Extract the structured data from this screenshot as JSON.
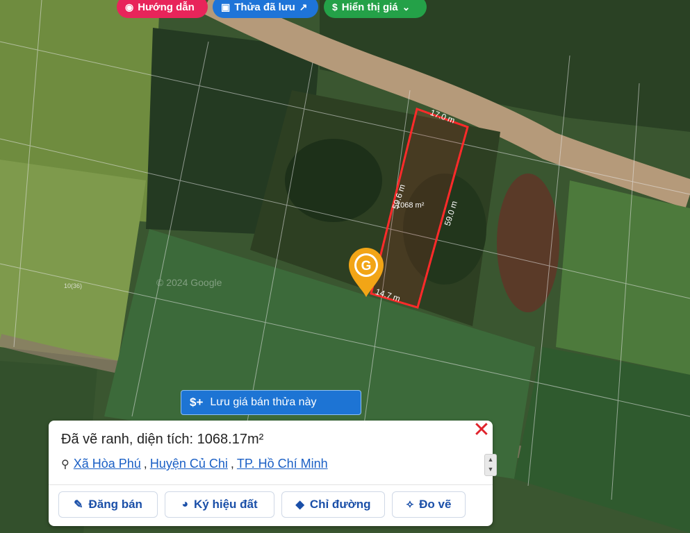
{
  "top_buttons": {
    "guide_label": "Hướng dẫn",
    "saved_label": "Thửa đã lưu",
    "price_label": "Hiển thị giá"
  },
  "map": {
    "watermark": "© 2024 Google",
    "parcel_top_dim": "17.0 m",
    "parcel_left_dim": "59.6 m",
    "parcel_right_dim": "59.0 m",
    "parcel_bottom_dim": "14.7 m",
    "parcel_area": "1068 m²",
    "parcel_id_label": "10(36)",
    "marker_letter": "G"
  },
  "save_price_button": {
    "icon_text": "$+",
    "label": "Lưu giá bán thửa này"
  },
  "card": {
    "title": "Đã vẽ ranh, diện tích: 1068.17m²",
    "address": {
      "commune": "Xã Hòa Phú",
      "district": "Huyện Củ Chi",
      "city": "TP. Hồ Chí Minh",
      "sep": ","
    },
    "actions": {
      "sell": "Đăng bán",
      "symbol": "Ký hiệu đất",
      "directions": "Chỉ đường",
      "measure": "Đo vẽ"
    }
  },
  "colors": {
    "parcel_outline": "#ff2a2a",
    "marker": "#f2a516",
    "primary_blue": "#1d74d4",
    "link_blue": "#1a5fc5"
  }
}
